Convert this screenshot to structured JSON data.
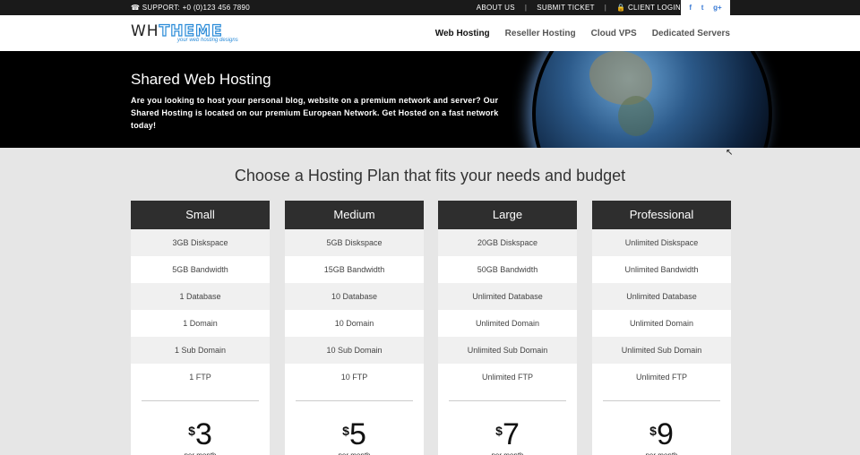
{
  "topbar": {
    "support": "☎ SUPPORT: +0 (0)123 456 7890",
    "about": "ABOUT US",
    "ticket": "SUBMIT TICKET",
    "login": "🔒 CLIENT LOGIN",
    "sep": "|"
  },
  "social": {
    "facebook": "f",
    "twitter": "t",
    "google": "g+"
  },
  "logo": {
    "wh": "WH",
    "theme": "THEME",
    "tagline": "your web hosting designs"
  },
  "menu": {
    "web": "Web Hosting",
    "reseller": "Reseller Hosting",
    "vps": "Cloud VPS",
    "dedicated": "Dedicated Servers"
  },
  "hero": {
    "title": "Shared Web Hosting",
    "text": "Are you looking to host your personal blog, website on a premium network and server? Our Shared Hosting is located on our premium European Network. Get Hosted on a fast network today!"
  },
  "section_title": "Choose a Hosting Plan that fits your needs and budget",
  "plans": [
    {
      "name": "Small",
      "features": [
        "3GB Diskspace",
        "5GB Bandwidth",
        "1 Database",
        "1 Domain",
        "1 Sub Domain",
        "1 FTP"
      ],
      "currency": "$",
      "price": "3",
      "period": "per month"
    },
    {
      "name": "Medium",
      "features": [
        "5GB Diskspace",
        "15GB Bandwidth",
        "10 Database",
        "10 Domain",
        "10 Sub Domain",
        "10 FTP"
      ],
      "currency": "$",
      "price": "5",
      "period": "per month"
    },
    {
      "name": "Large",
      "features": [
        "20GB Diskspace",
        "50GB Bandwidth",
        "Unlimited Database",
        "Unlimited Domain",
        "Unlimited Sub Domain",
        "Unlimited FTP"
      ],
      "currency": "$",
      "price": "7",
      "period": "per month"
    },
    {
      "name": "Professional",
      "features": [
        "Unlimited Diskspace",
        "Unlimited Bandwidth",
        "Unlimited Database",
        "Unlimited Domain",
        "Unlimited Sub Domain",
        "Unlimited FTP"
      ],
      "currency": "$",
      "price": "9",
      "period": "per month"
    }
  ]
}
